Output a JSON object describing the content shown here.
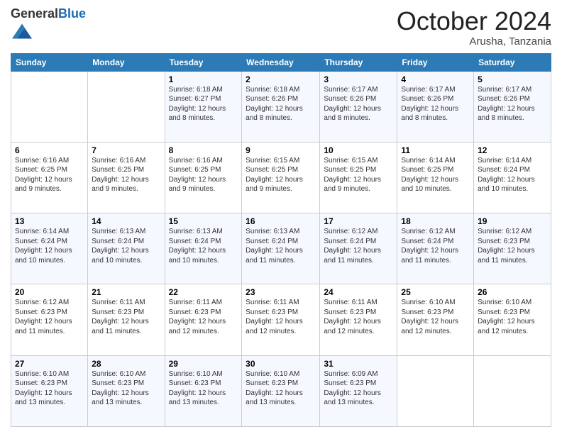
{
  "logo": {
    "general": "General",
    "blue": "Blue"
  },
  "header": {
    "month": "October 2024",
    "location": "Arusha, Tanzania"
  },
  "weekdays": [
    "Sunday",
    "Monday",
    "Tuesday",
    "Wednesday",
    "Thursday",
    "Friday",
    "Saturday"
  ],
  "weeks": [
    [
      {
        "day": "",
        "sunrise": "",
        "sunset": "",
        "daylight": ""
      },
      {
        "day": "",
        "sunrise": "",
        "sunset": "",
        "daylight": ""
      },
      {
        "day": "1",
        "sunrise": "Sunrise: 6:18 AM",
        "sunset": "Sunset: 6:27 PM",
        "daylight": "Daylight: 12 hours and 8 minutes."
      },
      {
        "day": "2",
        "sunrise": "Sunrise: 6:18 AM",
        "sunset": "Sunset: 6:26 PM",
        "daylight": "Daylight: 12 hours and 8 minutes."
      },
      {
        "day": "3",
        "sunrise": "Sunrise: 6:17 AM",
        "sunset": "Sunset: 6:26 PM",
        "daylight": "Daylight: 12 hours and 8 minutes."
      },
      {
        "day": "4",
        "sunrise": "Sunrise: 6:17 AM",
        "sunset": "Sunset: 6:26 PM",
        "daylight": "Daylight: 12 hours and 8 minutes."
      },
      {
        "day": "5",
        "sunrise": "Sunrise: 6:17 AM",
        "sunset": "Sunset: 6:26 PM",
        "daylight": "Daylight: 12 hours and 8 minutes."
      }
    ],
    [
      {
        "day": "6",
        "sunrise": "Sunrise: 6:16 AM",
        "sunset": "Sunset: 6:25 PM",
        "daylight": "Daylight: 12 hours and 9 minutes."
      },
      {
        "day": "7",
        "sunrise": "Sunrise: 6:16 AM",
        "sunset": "Sunset: 6:25 PM",
        "daylight": "Daylight: 12 hours and 9 minutes."
      },
      {
        "day": "8",
        "sunrise": "Sunrise: 6:16 AM",
        "sunset": "Sunset: 6:25 PM",
        "daylight": "Daylight: 12 hours and 9 minutes."
      },
      {
        "day": "9",
        "sunrise": "Sunrise: 6:15 AM",
        "sunset": "Sunset: 6:25 PM",
        "daylight": "Daylight: 12 hours and 9 minutes."
      },
      {
        "day": "10",
        "sunrise": "Sunrise: 6:15 AM",
        "sunset": "Sunset: 6:25 PM",
        "daylight": "Daylight: 12 hours and 9 minutes."
      },
      {
        "day": "11",
        "sunrise": "Sunrise: 6:14 AM",
        "sunset": "Sunset: 6:25 PM",
        "daylight": "Daylight: 12 hours and 10 minutes."
      },
      {
        "day": "12",
        "sunrise": "Sunrise: 6:14 AM",
        "sunset": "Sunset: 6:24 PM",
        "daylight": "Daylight: 12 hours and 10 minutes."
      }
    ],
    [
      {
        "day": "13",
        "sunrise": "Sunrise: 6:14 AM",
        "sunset": "Sunset: 6:24 PM",
        "daylight": "Daylight: 12 hours and 10 minutes."
      },
      {
        "day": "14",
        "sunrise": "Sunrise: 6:13 AM",
        "sunset": "Sunset: 6:24 PM",
        "daylight": "Daylight: 12 hours and 10 minutes."
      },
      {
        "day": "15",
        "sunrise": "Sunrise: 6:13 AM",
        "sunset": "Sunset: 6:24 PM",
        "daylight": "Daylight: 12 hours and 10 minutes."
      },
      {
        "day": "16",
        "sunrise": "Sunrise: 6:13 AM",
        "sunset": "Sunset: 6:24 PM",
        "daylight": "Daylight: 12 hours and 11 minutes."
      },
      {
        "day": "17",
        "sunrise": "Sunrise: 6:12 AM",
        "sunset": "Sunset: 6:24 PM",
        "daylight": "Daylight: 12 hours and 11 minutes."
      },
      {
        "day": "18",
        "sunrise": "Sunrise: 6:12 AM",
        "sunset": "Sunset: 6:24 PM",
        "daylight": "Daylight: 12 hours and 11 minutes."
      },
      {
        "day": "19",
        "sunrise": "Sunrise: 6:12 AM",
        "sunset": "Sunset: 6:23 PM",
        "daylight": "Daylight: 12 hours and 11 minutes."
      }
    ],
    [
      {
        "day": "20",
        "sunrise": "Sunrise: 6:12 AM",
        "sunset": "Sunset: 6:23 PM",
        "daylight": "Daylight: 12 hours and 11 minutes."
      },
      {
        "day": "21",
        "sunrise": "Sunrise: 6:11 AM",
        "sunset": "Sunset: 6:23 PM",
        "daylight": "Daylight: 12 hours and 11 minutes."
      },
      {
        "day": "22",
        "sunrise": "Sunrise: 6:11 AM",
        "sunset": "Sunset: 6:23 PM",
        "daylight": "Daylight: 12 hours and 12 minutes."
      },
      {
        "day": "23",
        "sunrise": "Sunrise: 6:11 AM",
        "sunset": "Sunset: 6:23 PM",
        "daylight": "Daylight: 12 hours and 12 minutes."
      },
      {
        "day": "24",
        "sunrise": "Sunrise: 6:11 AM",
        "sunset": "Sunset: 6:23 PM",
        "daylight": "Daylight: 12 hours and 12 minutes."
      },
      {
        "day": "25",
        "sunrise": "Sunrise: 6:10 AM",
        "sunset": "Sunset: 6:23 PM",
        "daylight": "Daylight: 12 hours and 12 minutes."
      },
      {
        "day": "26",
        "sunrise": "Sunrise: 6:10 AM",
        "sunset": "Sunset: 6:23 PM",
        "daylight": "Daylight: 12 hours and 12 minutes."
      }
    ],
    [
      {
        "day": "27",
        "sunrise": "Sunrise: 6:10 AM",
        "sunset": "Sunset: 6:23 PM",
        "daylight": "Daylight: 12 hours and 13 minutes."
      },
      {
        "day": "28",
        "sunrise": "Sunrise: 6:10 AM",
        "sunset": "Sunset: 6:23 PM",
        "daylight": "Daylight: 12 hours and 13 minutes."
      },
      {
        "day": "29",
        "sunrise": "Sunrise: 6:10 AM",
        "sunset": "Sunset: 6:23 PM",
        "daylight": "Daylight: 12 hours and 13 minutes."
      },
      {
        "day": "30",
        "sunrise": "Sunrise: 6:10 AM",
        "sunset": "Sunset: 6:23 PM",
        "daylight": "Daylight: 12 hours and 13 minutes."
      },
      {
        "day": "31",
        "sunrise": "Sunrise: 6:09 AM",
        "sunset": "Sunset: 6:23 PM",
        "daylight": "Daylight: 12 hours and 13 minutes."
      },
      {
        "day": "",
        "sunrise": "",
        "sunset": "",
        "daylight": ""
      },
      {
        "day": "",
        "sunrise": "",
        "sunset": "",
        "daylight": ""
      }
    ]
  ]
}
